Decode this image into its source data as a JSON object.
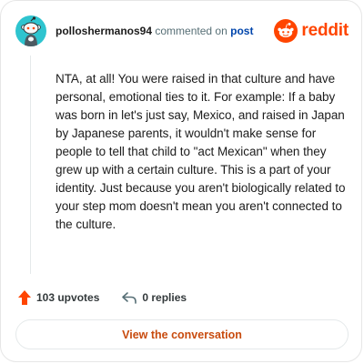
{
  "header": {
    "username": "polloshermanos94",
    "commented_text": "commented on",
    "post_link": "post",
    "brand_name": "reddit",
    "brand_color": "#ff4500",
    "avatar_color": "#2ec4cf",
    "avatar_icon": "snoo-avatar-icon"
  },
  "comment": {
    "body": "NTA, at all! You were raised in that culture and have personal, emotional ties to it. For example: If a baby was born in let's just say, Mexico, and raised in Japan by Japanese parents, it wouldn't make sense for people to tell that child to \"act Mexican\" when they grew up with a certain culture. This is a part of your identity. Just because you aren't biologically related to your step mom doesn't mean you aren't connected to the culture."
  },
  "actions": {
    "upvotes_label": "103 upvotes",
    "upvote_icon": "upvote-arrow-icon",
    "upvote_color": "#ff4500",
    "replies_label": "0 replies",
    "reply_icon": "reply-icon"
  },
  "cta": {
    "label": "View the conversation",
    "color": "#c84b0e"
  }
}
